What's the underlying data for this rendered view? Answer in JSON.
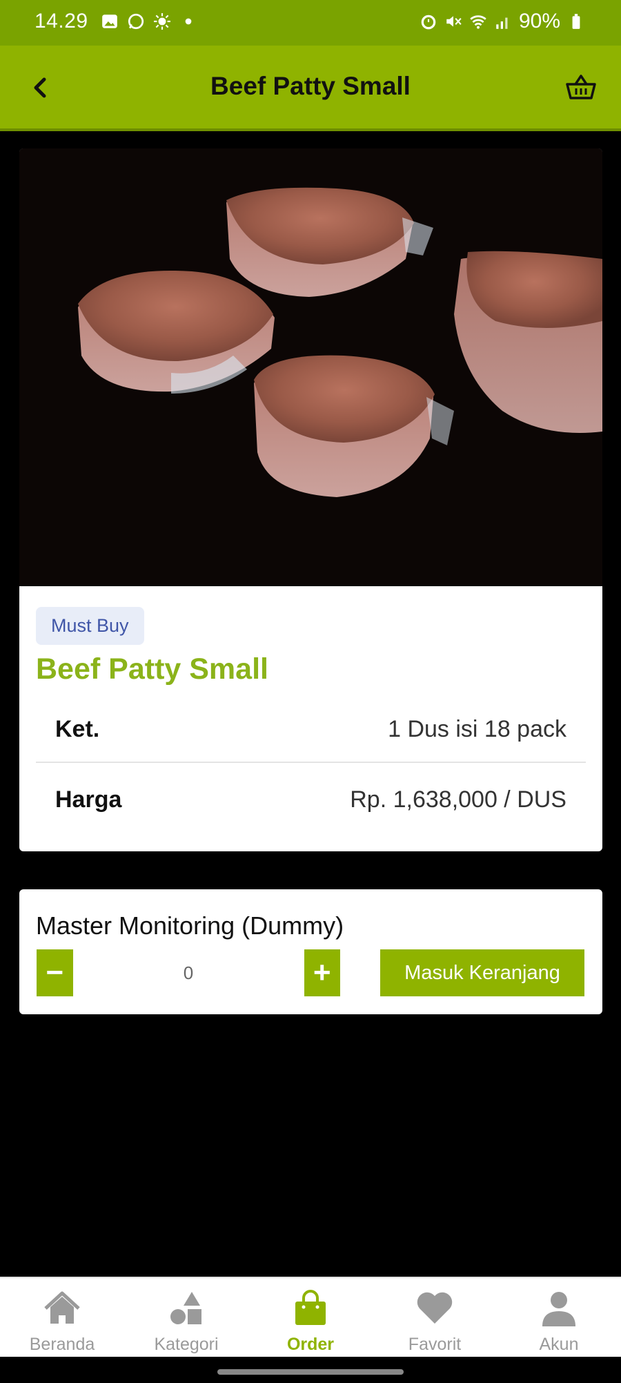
{
  "status_bar": {
    "time": "14.29",
    "battery": "90%"
  },
  "app_bar": {
    "title": "Beef Patty Small"
  },
  "product": {
    "badge": "Must Buy",
    "name": "Beef Patty Small",
    "details": [
      {
        "key": "Ket.",
        "value": "1 Dus isi 18 pack"
      },
      {
        "key": "Harga",
        "value": "Rp. 1,638,000 / DUS"
      }
    ]
  },
  "order_box": {
    "label": "Master Monitoring (Dummy)",
    "minus": "−",
    "plus": "+",
    "quantity": "0",
    "add_to_cart": "Masuk Keranjang"
  },
  "bottom_nav": {
    "items": [
      {
        "label": "Beranda",
        "icon": "home-icon"
      },
      {
        "label": "Kategori",
        "icon": "category-icon"
      },
      {
        "label": "Order",
        "icon": "shopping-bag-icon",
        "active": true
      },
      {
        "label": "Favorit",
        "icon": "heart-icon"
      },
      {
        "label": "Akun",
        "icon": "user-icon"
      }
    ]
  },
  "colors": {
    "primary": "#8fb300",
    "status_bar": "#7aa300",
    "product_name": "#8bb31a",
    "badge_text": "#4056a8"
  }
}
